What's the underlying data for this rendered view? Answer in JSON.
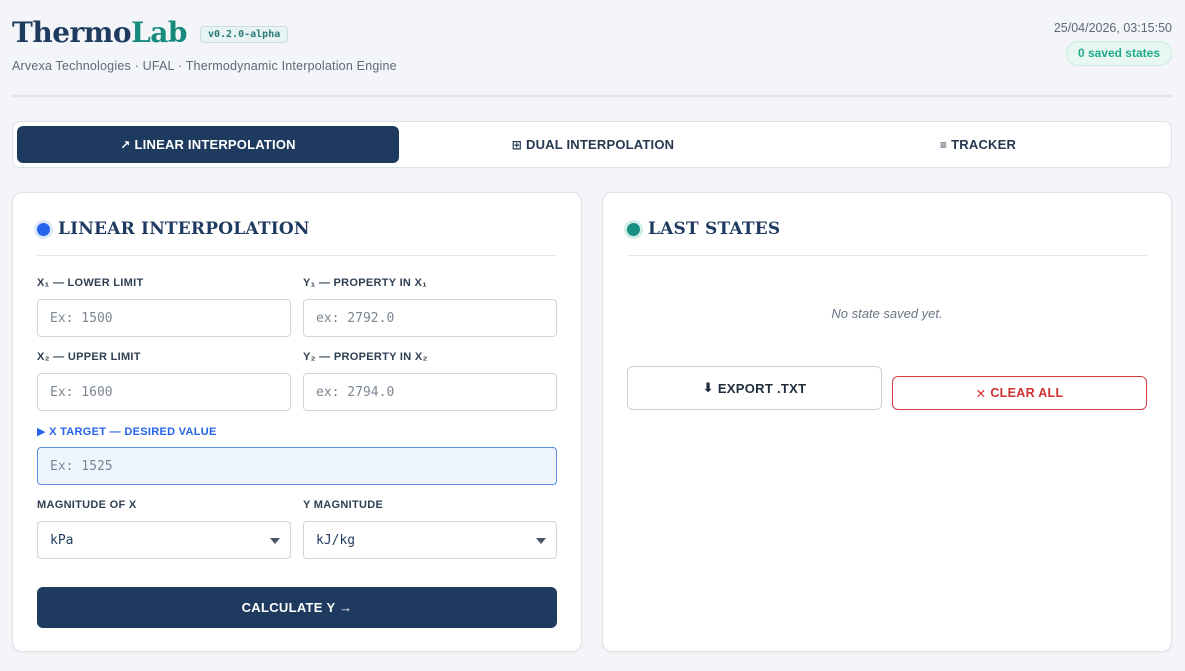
{
  "header": {
    "brand_part1": "Thermo",
    "brand_part2": "Lab",
    "version": "v0.2.0-alpha",
    "subtitle": "Arvexa Technologies · UFAL · Thermodynamic Interpolation Engine",
    "datetime": "25/04/2026, 03:15:50",
    "saved_states": "0 saved states"
  },
  "tabs": [
    {
      "icon": "↗",
      "label": "LINEAR INTERPOLATION",
      "active": true
    },
    {
      "icon": "⊞",
      "label": "DUAL INTERPOLATION",
      "active": false
    },
    {
      "icon": "≡",
      "label": "TRACKER",
      "active": false
    }
  ],
  "linear": {
    "title": "LINEAR INTERPOLATION",
    "x1_label": "X₁ — LOWER LIMIT",
    "x1_placeholder": "Ex: 1500",
    "y1_label": "Y₁ — PROPERTY IN X₁",
    "y1_placeholder": "ex: 2792.0",
    "x2_label": "X₂ — UPPER LIMIT",
    "x2_placeholder": "Ex: 1600",
    "y2_label": "Y₂ — PROPERTY IN X₂",
    "y2_placeholder": "ex: 2794.0",
    "target_label": "▶ X TARGET — DESIRED VALUE",
    "target_placeholder": "Ex: 1525",
    "mag_x_label": "MAGNITUDE OF X",
    "mag_x_value": "kPa",
    "mag_y_label": "Y MAGNITUDE",
    "mag_y_value": "kJ/kg",
    "calculate_label": "CALCULATE Y →"
  },
  "states": {
    "title": "LAST STATES",
    "empty_text": "No state saved yet.",
    "export_icon": "⬇",
    "export_label": "EXPORT .TXT",
    "clear_icon": "✕",
    "clear_label": "CLEAR ALL"
  },
  "colors": {
    "primary": "#1f3a5f",
    "teal": "#178a7e",
    "accent_blue": "#2563eb",
    "danger": "#cf2f2f"
  }
}
